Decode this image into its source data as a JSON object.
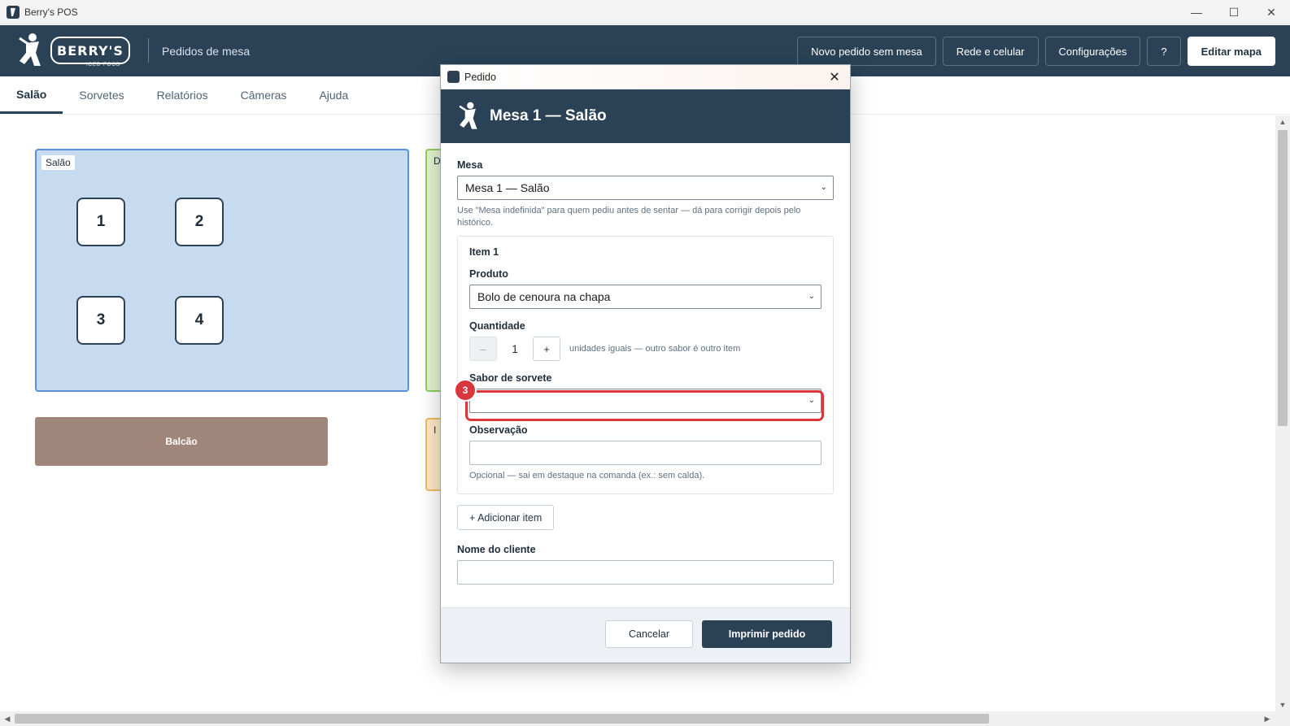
{
  "window": {
    "title": "Berry's POS",
    "controls": [
      "—",
      "☐",
      "✕"
    ]
  },
  "header": {
    "brand_name": "BERRY'S",
    "brand_sub": "ICED FOOD",
    "subtitle": "Pedidos de mesa",
    "actions": [
      {
        "label": "Novo pedido sem mesa"
      },
      {
        "label": "Rede e celular"
      },
      {
        "label": "Configurações"
      },
      {
        "label": "?"
      },
      {
        "label": "Editar mapa"
      }
    ]
  },
  "tabs": [
    {
      "label": "Salão",
      "active": true
    },
    {
      "label": "Sorvetes"
    },
    {
      "label": "Relatórios"
    },
    {
      "label": "Câmeras"
    },
    {
      "label": "Ajuda"
    }
  ],
  "map": {
    "salao_label": "Salão",
    "tables": [
      "1",
      "2",
      "3",
      "4"
    ],
    "green_area_label": "D",
    "orange_area_label": "I",
    "balcao_label": "Balcão",
    "colors": {
      "salao": "#c6daf0",
      "green": "#e2f3cf",
      "orange": "#fde9c7",
      "balcao": "#a0857b"
    }
  },
  "dialog": {
    "window_title": "Pedido",
    "header_title": "Mesa 1 — Salão",
    "mesa_label": "Mesa",
    "mesa_value": "Mesa 1 — Salão",
    "mesa_help": "Use \"Mesa indefinida\" para quem pediu antes de sentar — dá para corrigir depois pelo histórico.",
    "item": {
      "title": "Item 1",
      "produto_label": "Produto",
      "produto_value": "Bolo de cenoura na chapa",
      "quantidade_label": "Quantidade",
      "quantidade_value": "1",
      "minus": "–",
      "plus": "+",
      "quantidade_hint": "unidades iguais — outro sabor é outro item",
      "sabor_label": "Sabor de sorvete",
      "sabor_value": "",
      "highlight_badge": "3",
      "observacao_label": "Observação",
      "observacao_value": "",
      "observacao_help": "Opcional — sai em destaque na comanda (ex.: sem calda)."
    },
    "add_item_label": "+ Adicionar item",
    "cliente_label": "Nome do cliente",
    "cliente_value": "",
    "cancel_label": "Cancelar",
    "print_label": "Imprimir pedido",
    "accent": "#2b4256",
    "highlight_color": "#d9363e"
  }
}
